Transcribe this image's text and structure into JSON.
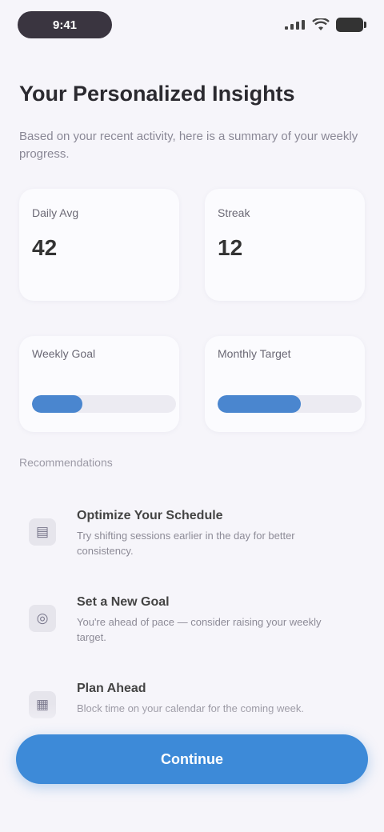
{
  "status_bar": {
    "time": "9:41"
  },
  "page": {
    "title": "Your Personalized Insights",
    "subtitle": "Based on your recent activity, here is a summary of your weekly progress."
  },
  "stats": [
    {
      "label": "Daily Avg",
      "value": "42"
    },
    {
      "label": "Streak",
      "value": "12"
    }
  ],
  "progress": [
    {
      "label": "Weekly Goal",
      "fraction": 0.35
    },
    {
      "label": "Monthly Target",
      "fraction": 0.58
    }
  ],
  "section": {
    "label": "Recommendations"
  },
  "tips": [
    {
      "icon": "chart-icon",
      "title": "Optimize Your Schedule",
      "desc": "Try shifting sessions earlier in the day for better consistency."
    },
    {
      "icon": "target-icon",
      "title": "Set a New Goal",
      "desc": "You're ahead of pace — consider raising your weekly target."
    },
    {
      "icon": "calendar-icon",
      "title": "Plan Ahead",
      "desc": "Block time on your calendar for the coming week."
    }
  ],
  "cta": {
    "label": "Continue"
  },
  "colors": {
    "accent": "#3d8ad8",
    "progress_fill": "#4a86cf",
    "background": "#f6f5fa"
  }
}
